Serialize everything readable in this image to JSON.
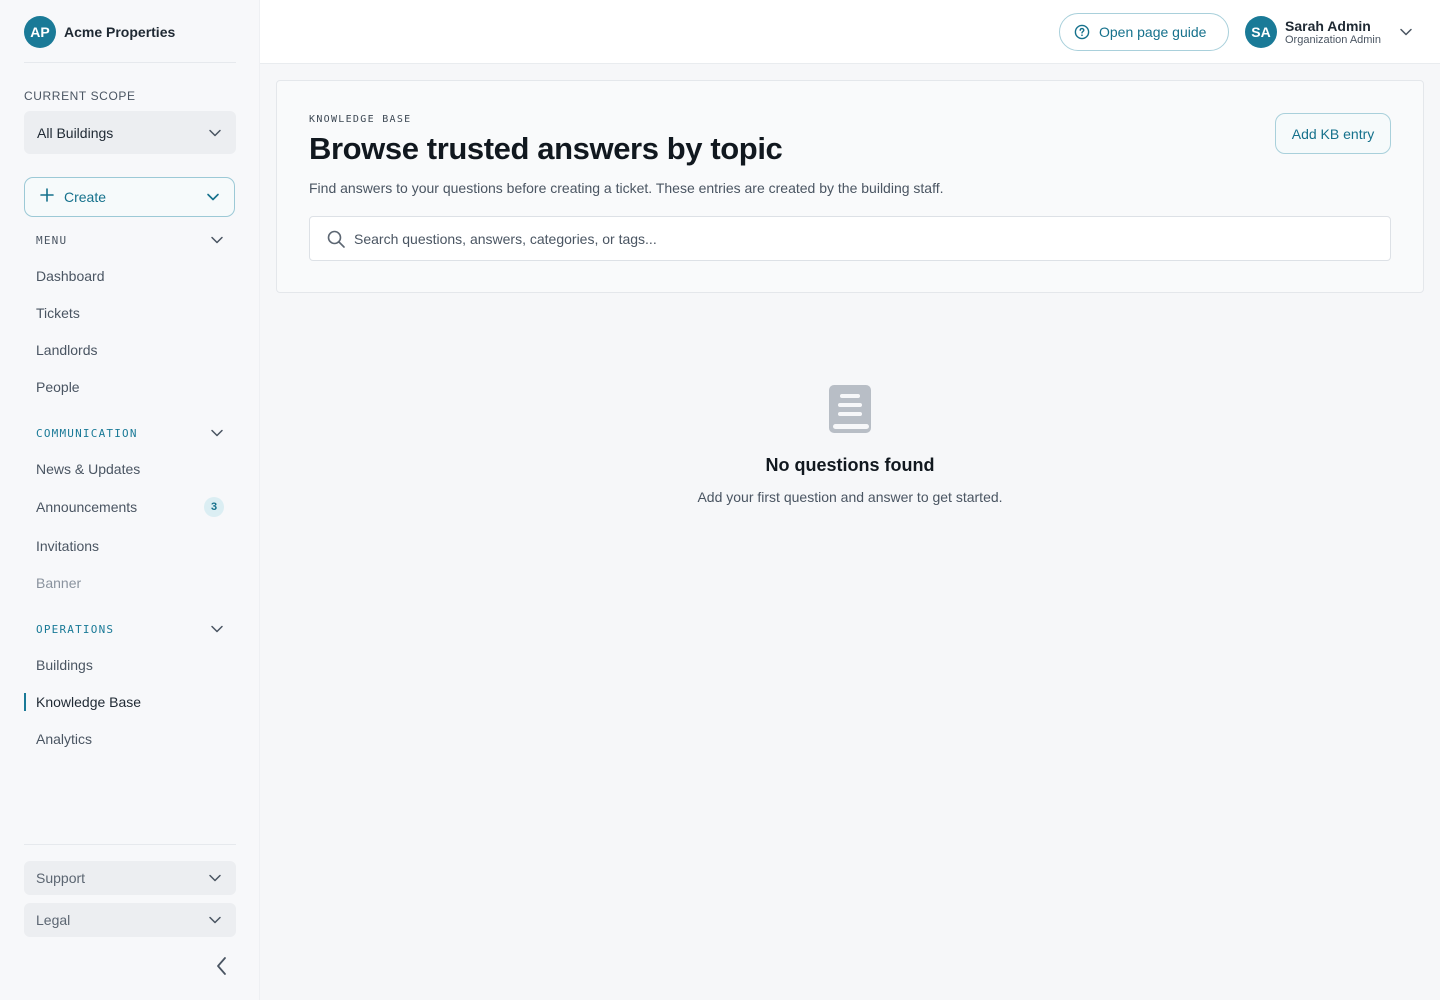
{
  "brand": {
    "initials": "AP",
    "name": "Acme Properties"
  },
  "scope": {
    "label": "CURRENT SCOPE",
    "selected": "All Buildings"
  },
  "create": {
    "label": "Create"
  },
  "sidebar": {
    "menu": {
      "title": "MENU",
      "items": [
        "Dashboard",
        "Tickets",
        "Landlords",
        "People"
      ]
    },
    "communication": {
      "title": "COMMUNICATION",
      "items": [
        {
          "label": "News & Updates"
        },
        {
          "label": "Announcements",
          "badge": "3"
        },
        {
          "label": "Invitations"
        },
        {
          "label": "Banner"
        }
      ]
    },
    "operations": {
      "title": "OPERATIONS",
      "items": [
        "Buildings",
        "Knowledge Base",
        "Analytics"
      ],
      "active": "Knowledge Base"
    },
    "footer": {
      "support": "Support",
      "legal": "Legal"
    }
  },
  "header": {
    "guide_label": "Open page guide",
    "user": {
      "initials": "SA",
      "name": "Sarah Admin",
      "role": "Organization Admin"
    }
  },
  "main": {
    "eyebrow": "KNOWLEDGE BASE",
    "title": "Browse trusted answers by topic",
    "description": "Find answers to your questions before creating a ticket. These entries are created by the building staff.",
    "add_label": "Add KB entry",
    "search_placeholder": "Search questions, answers, categories, or tags...",
    "empty": {
      "icon": "book-icon",
      "title": "No questions found",
      "description": "Add your first question and answer to get started."
    }
  },
  "colors": {
    "accent": "#1a7a97",
    "accent_text": "#15718c",
    "badge_bg": "#dbeef3"
  }
}
